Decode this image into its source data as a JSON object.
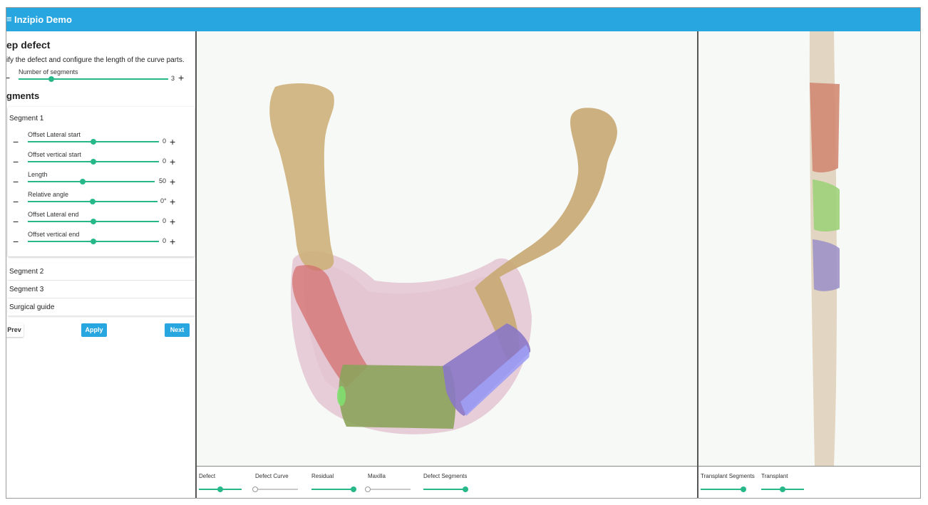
{
  "app": {
    "title": "Inzipio Demo",
    "menu_icon": "hamburger-menu-icon",
    "accent_color": "#27a6df",
    "slider_color": "#26b889"
  },
  "step": {
    "title": "ep defect",
    "description": "ify the defect and configure the length of the curve parts.",
    "segments_count": {
      "label": "Number of segments",
      "value": "3",
      "level_fraction": 0.22
    }
  },
  "segments_section": {
    "title": "gments",
    "segment1": {
      "title": "Segment 1",
      "sliders": [
        {
          "label": "Offset Lateral start",
          "value": "0",
          "level_fraction": 0.5
        },
        {
          "label": "Offset vertical start",
          "value": "0",
          "level_fraction": 0.5
        },
        {
          "label": "Length",
          "value": "50",
          "level_fraction": 0.43
        },
        {
          "label": "Relative angle",
          "value": "0°",
          "level_fraction": 0.5
        },
        {
          "label": "Offset Lateral end",
          "value": "0",
          "level_fraction": 0.5
        },
        {
          "label": "Offset vertical end",
          "value": "0",
          "level_fraction": 0.5
        }
      ]
    },
    "other_items": [
      "Segment 2",
      "Segment 3",
      "Surgical guide"
    ]
  },
  "buttons": {
    "prev": "Prev",
    "apply": "Apply",
    "next": "Next"
  },
  "main_view_layers": [
    {
      "label": "Defect",
      "on": true,
      "level_fraction": 0.5
    },
    {
      "label": "Defect Curve",
      "on": false,
      "level_fraction": 0.0
    },
    {
      "label": "Residual",
      "on": true,
      "level_fraction": 1.0
    },
    {
      "label": "Maxilla",
      "on": false,
      "level_fraction": 0.0
    },
    {
      "label": "Defect Segments",
      "on": true,
      "level_fraction": 1.0
    }
  ],
  "transplant_view_layers": [
    {
      "label": "Transplant Segments",
      "on": true,
      "level_fraction": 1.0
    },
    {
      "label": "Transplant",
      "on": true,
      "level_fraction": 0.5
    }
  ]
}
